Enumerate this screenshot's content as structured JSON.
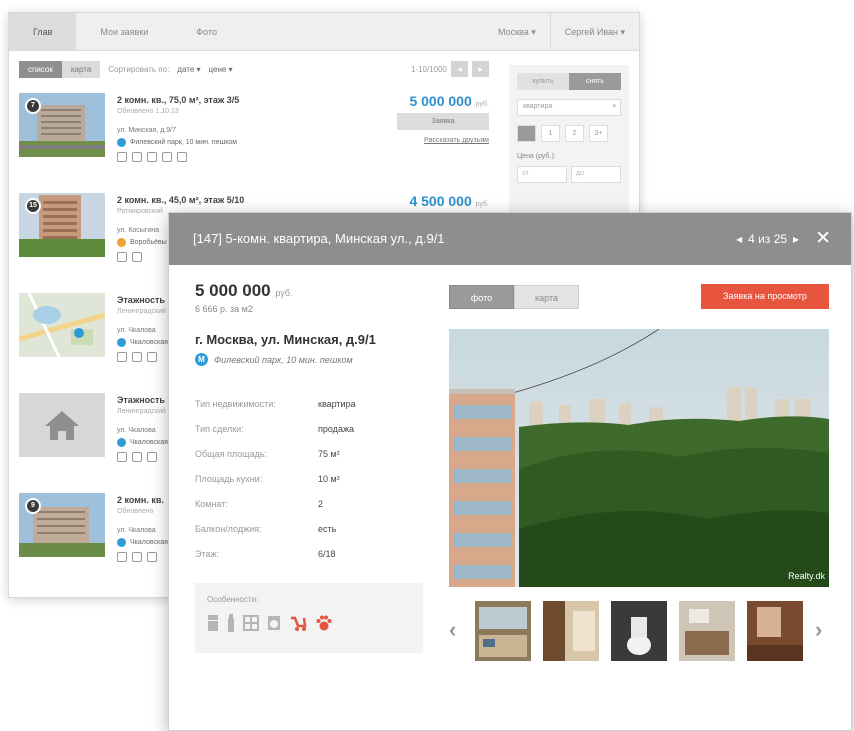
{
  "back_window": {
    "tabs": [
      {
        "label": "Глав",
        "active": true
      },
      {
        "label": "Мои заявки",
        "active": false
      },
      {
        "label": "Фото",
        "active": false
      }
    ],
    "top_right": [
      "Москва ▾",
      "Сергей Иван ▾"
    ],
    "view_toggle": {
      "list": "список",
      "map": "карта"
    },
    "sort": {
      "label": "Сортировать по:",
      "by_date": "дате ▾",
      "by_price": "цене ▾"
    },
    "pager": {
      "range": "1-10/1000"
    },
    "listings": [
      {
        "badge": "7",
        "title": "2 комн. кв., 75,0 м², этаж 3/5",
        "subtitle": "Обновлено 1.10.13",
        "address": "ул. Минская, д.9/7",
        "metro": "Филевский парк, 10 мин. пешком",
        "price": "5 000 000",
        "currency": "руб.",
        "button": "Заявка",
        "link": "Рассказать друзьям"
      },
      {
        "badge": "15",
        "title": "2 комн. кв., 45,0 м², этаж 5/10",
        "subtitle": "Ратмировский",
        "address": "ул. Косыгина",
        "metro": "Воробьёвы",
        "price": "4 500 000",
        "currency": "руб.",
        "button": "",
        "link": ""
      },
      {
        "badge": "",
        "title": "Этажность",
        "subtitle": "Ленинградский",
        "address": "ул. Чкалова",
        "metro": "Чкаловская",
        "price": "",
        "currency": "",
        "button": "",
        "link": ""
      },
      {
        "badge": "",
        "title": "Этажность",
        "subtitle": "Ленинградский",
        "address": "ул. Чкалова",
        "metro": "Чкаловская",
        "price": "",
        "currency": "",
        "button": "",
        "link": ""
      },
      {
        "badge": "9",
        "title": "2 комн. кв.",
        "subtitle": "Обновлено",
        "address": "ул. Чкалова",
        "metro": "Чкаловская",
        "price": "",
        "currency": "",
        "button": "",
        "link": ""
      }
    ],
    "filter": {
      "toggle": [
        "купить",
        "снять"
      ],
      "type_select": "квартира",
      "rooms": [
        "",
        "1",
        "2",
        "3+"
      ],
      "price_label": "Цена (руб.):",
      "price_from": "от",
      "price_to": "до"
    }
  },
  "modal": {
    "title": "[147] 5-комн. квартира, Минская ул., д.9/1",
    "nav": {
      "prev": "◂",
      "counter": "4 из 25",
      "next": "▸",
      "close": "✕"
    },
    "price": "5 000 000",
    "currency": "руб.",
    "price_per_m2": "6 666 р. за м2",
    "address": "г. Москва, ул. Минская, д.9/1",
    "metro_badge": "М",
    "metro": "Филевский парк, 10 мин. пешком",
    "properties": [
      {
        "key": "Тип недвижимости:",
        "value": "квартира"
      },
      {
        "key": "Тип сделки:",
        "value": "продажа"
      },
      {
        "key": "Общая площадь:",
        "value": "75 м²"
      },
      {
        "key": "Площадь кухни:",
        "value": "10 м²"
      },
      {
        "key": "Комнат:",
        "value": "2"
      },
      {
        "key": "Балкон/лоджия:",
        "value": "есть"
      },
      {
        "key": "Этаж:",
        "value": "6/18"
      }
    ],
    "features_title": "Особенности:",
    "view_toggle": {
      "photo": "фото",
      "map": "карта"
    },
    "request_button": "Заявка на просмотр",
    "watermark": "Realty.dk",
    "gallery_prev": "‹",
    "gallery_next": "›",
    "colors": {
      "header": "#8e8e8e",
      "accent": "#e8553f",
      "price_blue": "#2f90cf",
      "metro": "#2f9ad8"
    }
  }
}
